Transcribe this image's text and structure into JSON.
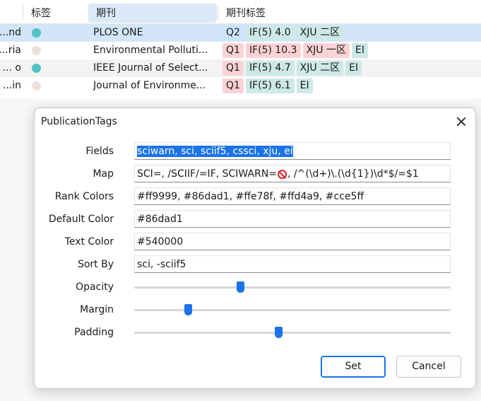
{
  "table": {
    "headers": [
      "标签",
      "期刊",
      "期刊标签"
    ],
    "rows": [
      {
        "prefix": "nd...",
        "dot": "#4fc3c3",
        "journal": "PLOS ONE",
        "tags": [
          {
            "t": "Q2",
            "c": "#cce5ff"
          },
          {
            "t": "IF(5) 4.0",
            "c": "#cde9e6"
          },
          {
            "t": "XJU 二区",
            "c": "#cde9e6"
          }
        ]
      },
      {
        "prefix": "ria...",
        "dot": "#ece2dc",
        "journal": "Environmental Polluti...",
        "tags": [
          {
            "t": "Q1",
            "c": "#fcd2d5"
          },
          {
            "t": "IF(5) 10.3",
            "c": "#fcd2d5"
          },
          {
            "t": "XJU 一区",
            "c": "#fcd2d5"
          },
          {
            "t": "EI",
            "c": "#cde9e6"
          }
        ]
      },
      {
        "prefix": "o ...",
        "dot": "#4fc3c3",
        "journal": "IEEE Journal of Select...",
        "tags": [
          {
            "t": "Q1",
            "c": "#fcd2d5"
          },
          {
            "t": "IF(5) 4.7",
            "c": "#cde9e6"
          },
          {
            "t": "XJU 二区",
            "c": "#cde9e6"
          },
          {
            "t": "EI",
            "c": "#cde9e6"
          }
        ]
      },
      {
        "prefix": "in...",
        "dot": "#ece2dc",
        "journal": "Journal of Environme...",
        "tags": [
          {
            "t": "Q1",
            "c": "#fcd2d5"
          },
          {
            "t": "IF(5) 6.1",
            "c": "#cde9e6"
          },
          {
            "t": "EI",
            "c": "#cde9e6"
          }
        ]
      }
    ]
  },
  "dialog": {
    "title": "PublicationTags",
    "fields": {
      "fields_label": "Fields",
      "fields_value": "sciwarn, sci, sciif5, cssci, xju, ei",
      "map_label": "Map",
      "map_value_a": "SCI=, /SCIIF/=IF, SCIWARN=",
      "map_value_b": ", /^(\\d+)\\.(\\d{1})\\d*$/=$1",
      "rank_label": "Rank Colors",
      "rank_value": "#ff9999, #86dad1, #ffe78f, #ffd4a9, #cce5ff",
      "default_label": "Default Color",
      "default_value": "#86dad1",
      "text_label": "Text Color",
      "text_value": "#540000",
      "sort_label": "Sort By",
      "sort_value": "sci, -sciif5"
    },
    "sliders": {
      "opacity_label": "Opacity",
      "opacity_level": 0.335,
      "margin_label": "Margin",
      "margin_level": 0.17,
      "padding_label": "Padding",
      "padding_level": 0.455
    },
    "set_label": "Set",
    "cancel_label": "Cancel"
  }
}
